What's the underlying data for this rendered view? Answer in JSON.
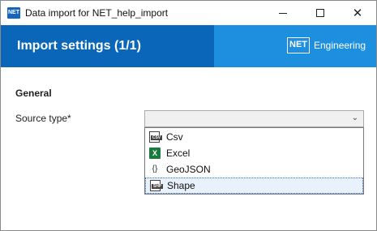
{
  "window": {
    "app_icon": "NET",
    "title": "Data import for NET_help_import",
    "controls": {
      "minimize": "minimize-icon",
      "maximize": "maximize-icon",
      "close": "close-icon"
    }
  },
  "banner": {
    "title": "Import settings (1/1)",
    "brand_mark": "NET",
    "brand_text": "Engineering",
    "colors": {
      "primary": "#0a66b8",
      "secondary": "#1d8fde"
    }
  },
  "form": {
    "section": "General",
    "source_type_label": "Source type*",
    "source_type_value": "",
    "options": [
      {
        "label": "Csv",
        "icon": "csv-file-icon",
        "tag": "CSV"
      },
      {
        "label": "Excel",
        "icon": "excel-icon",
        "tag": "X"
      },
      {
        "label": "GeoJSON",
        "icon": "geojson-icon",
        "tag": "{}"
      },
      {
        "label": "Shape",
        "icon": "shape-file-icon",
        "tag": "SHP",
        "highlighted": true
      }
    ]
  }
}
